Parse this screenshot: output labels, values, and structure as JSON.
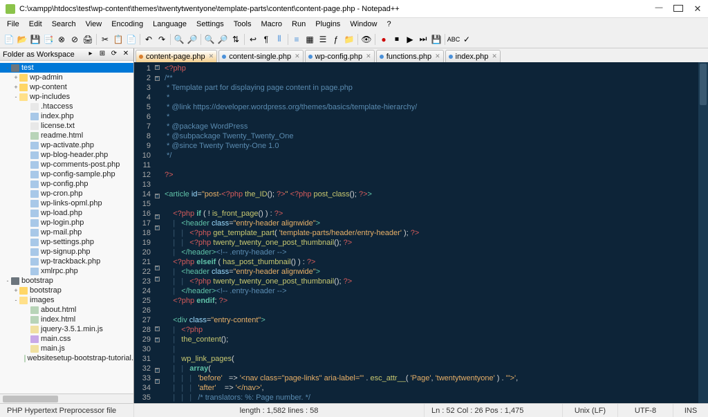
{
  "window": {
    "title": "C:\\xampp\\htdocs\\test\\wp-content\\themes\\twentytwentyone\\template-parts\\content\\content-page.php - Notepad++"
  },
  "menu": [
    "File",
    "Edit",
    "Search",
    "View",
    "Encoding",
    "Language",
    "Settings",
    "Tools",
    "Macro",
    "Run",
    "Plugins",
    "Window",
    "?"
  ],
  "sidebar": {
    "title": "Folder as Workspace",
    "tree": [
      {
        "t": "hdd",
        "e": "-",
        "l": 0,
        "n": "test",
        "sel": true
      },
      {
        "t": "folder",
        "e": "+",
        "l": 1,
        "n": "wp-admin"
      },
      {
        "t": "folder",
        "e": "+",
        "l": 1,
        "n": "wp-content"
      },
      {
        "t": "folder-open",
        "e": "-",
        "l": 1,
        "n": "wp-includes"
      },
      {
        "t": "txt",
        "e": "",
        "l": 2,
        "n": ".htaccess"
      },
      {
        "t": "php",
        "e": "",
        "l": 2,
        "n": "index.php"
      },
      {
        "t": "txt",
        "e": "",
        "l": 2,
        "n": "license.txt"
      },
      {
        "t": "html",
        "e": "",
        "l": 2,
        "n": "readme.html"
      },
      {
        "t": "php",
        "e": "",
        "l": 2,
        "n": "wp-activate.php"
      },
      {
        "t": "php",
        "e": "",
        "l": 2,
        "n": "wp-blog-header.php"
      },
      {
        "t": "php",
        "e": "",
        "l": 2,
        "n": "wp-comments-post.php"
      },
      {
        "t": "php",
        "e": "",
        "l": 2,
        "n": "wp-config-sample.php"
      },
      {
        "t": "php",
        "e": "",
        "l": 2,
        "n": "wp-config.php"
      },
      {
        "t": "php",
        "e": "",
        "l": 2,
        "n": "wp-cron.php"
      },
      {
        "t": "php",
        "e": "",
        "l": 2,
        "n": "wp-links-opml.php"
      },
      {
        "t": "php",
        "e": "",
        "l": 2,
        "n": "wp-load.php"
      },
      {
        "t": "php",
        "e": "",
        "l": 2,
        "n": "wp-login.php"
      },
      {
        "t": "php",
        "e": "",
        "l": 2,
        "n": "wp-mail.php"
      },
      {
        "t": "php",
        "e": "",
        "l": 2,
        "n": "wp-settings.php"
      },
      {
        "t": "php",
        "e": "",
        "l": 2,
        "n": "wp-signup.php"
      },
      {
        "t": "php",
        "e": "",
        "l": 2,
        "n": "wp-trackback.php"
      },
      {
        "t": "php",
        "e": "",
        "l": 2,
        "n": "xmlrpc.php"
      },
      {
        "t": "hdd",
        "e": "-",
        "l": 0,
        "n": "bootstrap"
      },
      {
        "t": "folder",
        "e": "+",
        "l": 1,
        "n": "bootstrap"
      },
      {
        "t": "folder-open",
        "e": "-",
        "l": 1,
        "n": "images"
      },
      {
        "t": "html",
        "e": "",
        "l": 2,
        "n": "about.html"
      },
      {
        "t": "html",
        "e": "",
        "l": 2,
        "n": "index.html"
      },
      {
        "t": "js",
        "e": "",
        "l": 2,
        "n": "jquery-3.5.1.min.js"
      },
      {
        "t": "css",
        "e": "",
        "l": 2,
        "n": "main.css"
      },
      {
        "t": "js",
        "e": "",
        "l": 2,
        "n": "main.js"
      },
      {
        "t": "html",
        "e": "",
        "l": 2,
        "n": "websitesetup-bootstrap-tutorial."
      }
    ]
  },
  "tabs": [
    {
      "label": "content-page.php",
      "active": true
    },
    {
      "label": "content-single.php",
      "active": false
    },
    {
      "label": "wp-config.php",
      "active": false
    },
    {
      "label": "functions.php",
      "active": false
    },
    {
      "label": "index.php",
      "active": false
    }
  ],
  "code": {
    "lines": [
      {
        "n": 1,
        "h": "<span class='c-php'>&lt;?php</span>"
      },
      {
        "n": 2,
        "h": "<span class='c-cmt'>/**</span>"
      },
      {
        "n": 3,
        "h": "<span class='c-cmt'> * Template part for displaying page content in page.php</span>"
      },
      {
        "n": 4,
        "h": "<span class='c-cmt'> *</span>"
      },
      {
        "n": 5,
        "h": "<span class='c-cmt'> * @link https://developer.wordpress.org/themes/basics/template-hierarchy/</span>"
      },
      {
        "n": 6,
        "h": "<span class='c-cmt'> *</span>"
      },
      {
        "n": 7,
        "h": "<span class='c-cmt'> * @package WordPress</span>"
      },
      {
        "n": 8,
        "h": "<span class='c-cmt'> * @subpackage Twenty_Twenty_One</span>"
      },
      {
        "n": 9,
        "h": "<span class='c-cmt'> * @since Twenty Twenty-One 1.0</span>"
      },
      {
        "n": 10,
        "h": "<span class='c-cmt'> */</span>"
      },
      {
        "n": 11,
        "h": ""
      },
      {
        "n": 12,
        "h": "<span class='c-php'>?&gt;</span>"
      },
      {
        "n": 13,
        "h": ""
      },
      {
        "n": 14,
        "h": "<span class='c-tag'>&lt;article</span> <span class='c-attr'>id</span>=<span class='c-str'>\"post-</span><span class='c-php'>&lt;?php</span> <span class='c-fn'>the_ID</span>(); <span class='c-php'>?&gt;</span><span class='c-str'>\"</span> <span class='c-php'>&lt;?php</span> <span class='c-fn'>post_class</span>(); <span class='c-php'>?&gt;</span><span class='c-tag'>&gt;</span>"
      },
      {
        "n": 15,
        "h": ""
      },
      {
        "n": 16,
        "h": "    <span class='c-php'>&lt;?php</span> <span class='c-kw'>if</span> ( <span class='c-op'>!</span> <span class='c-fn'>is_front_page</span>() ) : <span class='c-php'>?&gt;</span>"
      },
      {
        "n": 17,
        "h": "    <span class='c-pipe'>|</span>   <span class='c-tag'>&lt;header</span> <span class='c-attr'>class</span>=<span class='c-str'>\"entry-header alignwide\"</span><span class='c-tag'>&gt;</span>"
      },
      {
        "n": 18,
        "h": "    <span class='c-pipe'>|</span>   <span class='c-pipe'>|</span>   <span class='c-php'>&lt;?php</span> <span class='c-fn'>get_template_part</span>( <span class='c-str'>'template-parts/header/entry-header'</span> ); <span class='c-php'>?&gt;</span>"
      },
      {
        "n": 19,
        "h": "    <span class='c-pipe'>|</span>   <span class='c-pipe'>|</span>   <span class='c-php'>&lt;?php</span> <span class='c-fn'>twenty_twenty_one_post_thumbnail</span>(); <span class='c-php'>?&gt;</span>"
      },
      {
        "n": 20,
        "h": "    <span class='c-pipe'>|</span>   <span class='c-tag'>&lt;/header&gt;</span><span class='c-cmt'>&lt;!-- .entry-header --&gt;</span>"
      },
      {
        "n": 21,
        "h": "    <span class='c-php'>&lt;?php</span> <span class='c-kw'>elseif</span> ( <span class='c-fn'>has_post_thumbnail</span>() ) : <span class='c-php'>?&gt;</span>"
      },
      {
        "n": 22,
        "h": "    <span class='c-pipe'>|</span>   <span class='c-tag'>&lt;header</span> <span class='c-attr'>class</span>=<span class='c-str'>\"entry-header alignwide\"</span><span class='c-tag'>&gt;</span>"
      },
      {
        "n": 23,
        "h": "    <span class='c-pipe'>|</span>   <span class='c-pipe'>|</span>   <span class='c-php'>&lt;?php</span> <span class='c-fn'>twenty_twenty_one_post_thumbnail</span>(); <span class='c-php'>?&gt;</span>"
      },
      {
        "n": 24,
        "h": "    <span class='c-pipe'>|</span>   <span class='c-tag'>&lt;/header&gt;</span><span class='c-cmt'>&lt;!-- .entry-header --&gt;</span>"
      },
      {
        "n": 25,
        "h": "    <span class='c-php'>&lt;?php</span> <span class='c-kw'>endif</span>; <span class='c-php'>?&gt;</span>"
      },
      {
        "n": 26,
        "h": ""
      },
      {
        "n": 27,
        "h": "    <span class='c-tag'>&lt;div</span> <span class='c-attr'>class</span>=<span class='c-str'>\"entry-content\"</span><span class='c-tag'>&gt;</span>"
      },
      {
        "n": 28,
        "h": "    <span class='c-pipe'>|</span>   <span class='c-php'>&lt;?php</span>"
      },
      {
        "n": 29,
        "h": "    <span class='c-pipe'>|</span>   <span class='c-fn'>the_content</span>();"
      },
      {
        "n": 30,
        "h": "    <span class='c-pipe'>|</span>"
      },
      {
        "n": 31,
        "h": "    <span class='c-pipe'>|</span>   <span class='c-fn'>wp_link_pages</span>("
      },
      {
        "n": 32,
        "h": "    <span class='c-pipe'>|</span>   <span class='c-pipe'>|</span>   <span class='c-kw'>array</span>("
      },
      {
        "n": 33,
        "h": "    <span class='c-pipe'>|</span>   <span class='c-pipe'>|</span>   <span class='c-pipe'>|</span>   <span class='c-str'>'before'</span>   =&gt; <span class='c-str'>'&lt;nav class=\"page-links\" aria-label=\"'</span> . <span class='c-fn'>esc_attr__</span>( <span class='c-str'>'Page'</span>, <span class='c-str'>'twentytwentyone'</span> ) . <span class='c-str'>'\"&gt;'</span>,"
      },
      {
        "n": 34,
        "h": "    <span class='c-pipe'>|</span>   <span class='c-pipe'>|</span>   <span class='c-pipe'>|</span>   <span class='c-str'>'after'</span>    =&gt; <span class='c-str'>'&lt;/nav&gt;'</span>,"
      },
      {
        "n": 35,
        "h": "    <span class='c-pipe'>|</span>   <span class='c-pipe'>|</span>   <span class='c-pipe'>|</span>   <span class='c-cmt'>/* translators: %: Page number. */</span>"
      }
    ]
  },
  "status": {
    "lang": "PHP Hypertext Preprocessor file",
    "length": "length : 1,582    lines : 58",
    "pos": "Ln : 52    Col : 26    Pos : 1,475",
    "eol": "Unix (LF)",
    "enc": "UTF-8",
    "ins": "INS"
  }
}
